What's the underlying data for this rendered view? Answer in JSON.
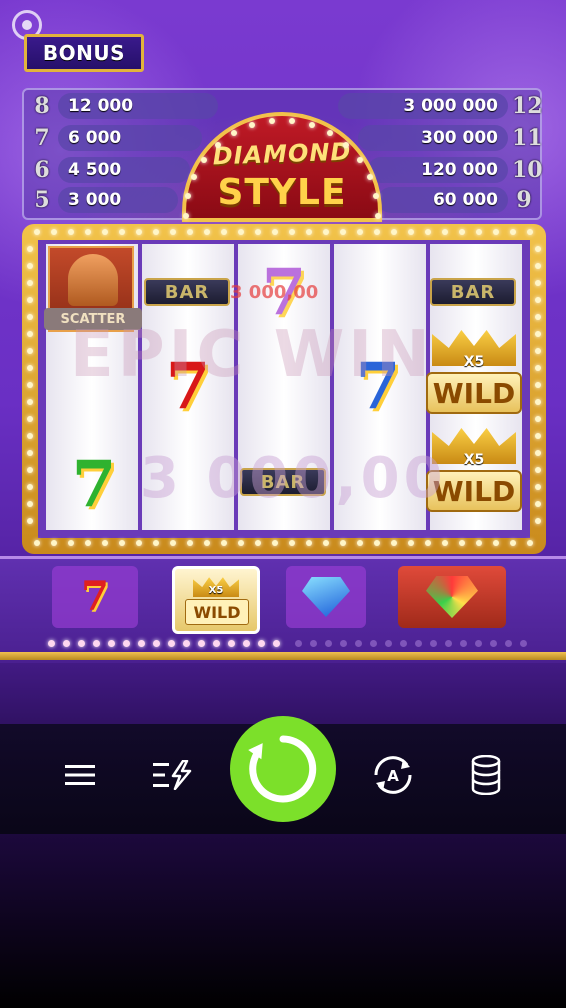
{
  "bonus_button": {
    "label": "BONUS"
  },
  "jackpots": {
    "left": [
      {
        "num": "8",
        "amount": "12 000"
      },
      {
        "num": "7",
        "amount": "6 000"
      },
      {
        "num": "6",
        "amount": "4 500"
      },
      {
        "num": "5",
        "amount": "3 000"
      }
    ],
    "right": [
      {
        "num": "12",
        "amount": "3 000 000"
      },
      {
        "num": "11",
        "amount": "300 000"
      },
      {
        "num": "10",
        "amount": "120 000"
      },
      {
        "num": "9",
        "amount": "60 000"
      }
    ]
  },
  "logo": {
    "line1": "DIAMOND",
    "line2": "STYLE"
  },
  "reels": {
    "symbols": {
      "scatter_label": "SCATTER",
      "bar_label": "BAR",
      "seven": "7",
      "wild_label": "WILD",
      "wild_multiplier": "X5"
    }
  },
  "overlay": {
    "epic_win": "EPIC WIN",
    "win_amount_big": "3 000,00",
    "win_amount_small": "3 000,00"
  },
  "tray": {
    "seven": "7",
    "wild_label": "WILD",
    "wild_multiplier": "X5"
  },
  "controls": {
    "menu_icon": "hamburger-menu-icon",
    "turbo_icon": "turbo-lines-icon",
    "spin_icon": "spin-refresh-icon",
    "autoplay_icon": "autoplay-a-icon",
    "bet_icon": "coin-stack-icon",
    "autoplay_letter": "A"
  },
  "colors": {
    "spin_button": "#7ce02a",
    "frame_gold": "#f2c34a",
    "background_purple": "#6a2fc4"
  }
}
